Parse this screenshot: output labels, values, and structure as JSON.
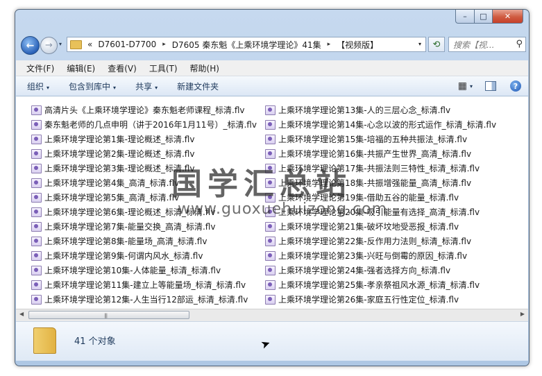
{
  "window": {
    "caption": {
      "minimize": "–",
      "maximize": "□",
      "close": "✕"
    }
  },
  "nav": {
    "back": "←",
    "forward": "→",
    "breadcrumb_lead": "«",
    "breadcrumb": [
      "D7601-D7700",
      "D7605 秦东魁《上乘环境学理论》41集",
      "【视频版】"
    ],
    "search_placeholder": "搜索【视...",
    "refresh": "⟲"
  },
  "menu": [
    "文件(F)",
    "编辑(E)",
    "查看(V)",
    "工具(T)",
    "帮助(H)"
  ],
  "toolbar": {
    "items": [
      {
        "label": "组织",
        "has_arrow": true
      },
      {
        "label": "包含到库中",
        "has_arrow": true
      },
      {
        "label": "共享",
        "has_arrow": true
      },
      {
        "label": "新建文件夹",
        "has_arrow": false
      }
    ],
    "help": "?"
  },
  "files": {
    "left": [
      "高清片头《上乘环境学理论》秦东魁老师课程_标清.flv",
      "秦东魁老师的几点申明（讲于2016年1月11号）_标清.flv",
      "上乘环境学理论第1集-理论概述_标清.flv",
      "上乘环境学理论第2集-理论概述_标清.flv",
      "上乘环境学理论第3集-理论概述_标清.flv",
      "上乘环境学理论第4集_高清_标清.flv",
      "上乘环境学理论第5集_高清_标清.flv",
      "上乘环境学理论第6集-理论概述_标清_标清.flv",
      "上乘环境学理论第7集-能量交换_高清_标清.flv",
      "上乘环境学理论第8集-能量场_高清_标清.flv",
      "上乘环境学理论第9集-何谓内风水_标清.flv",
      "上乘环境学理论第10集-人体能量_标清_标清.flv",
      "上乘环境学理论第11集-建立上等能量场_标清_标清.flv",
      "上乘环境学理论第12集-人生当行12部运_标清_标清.flv"
    ],
    "right": [
      "上乘环境学理论第13集-人的三层心念_标清.flv",
      "上乘环境学理论第14集-心念以波的形式运作_标清_标清.flv",
      "上乘环境学理论第15集-培福的五种共振法_标清.flv",
      "上乘环境学理论第16集-共振产生世界_高清_标清.flv",
      "上乘环境学理论第17集-共振法则三特性_标清_标清.flv",
      "上乘环境学理论第18集-共振增强能量_高清_标清.flv",
      "上乘环境学理论第19集-借助五谷的能量_标清.flv",
      "上乘环境学理论第20集-吸引能量有选择_高清_标清.flv",
      "上乘环境学理论第21集-破坏坟地受恶报_标清.flv",
      "上乘环境学理论第22集-反作用力法则_标清_标清.flv",
      "上乘环境学理论第23集-兴旺与倒霉的原因_标清.flv",
      "上乘环境学理论第24集-强者选择方向_标清.flv",
      "上乘环境学理论第25集-孝亲祭祖风水源_标清_标清.flv",
      "上乘环境学理论第26集-家庭五行性定位_标清.flv"
    ]
  },
  "watermark": {
    "text": "国学汇总站",
    "url": "www.guoxuehuizong.com"
  },
  "status": {
    "count_text": "41 个对象"
  },
  "scroll": {
    "left": "◀",
    "right": "▶",
    "grip": "|||"
  },
  "icons": {
    "dropdown": "▾",
    "sep": "▸",
    "search": "⚲",
    "view": "▦",
    "cursor": "➤"
  }
}
